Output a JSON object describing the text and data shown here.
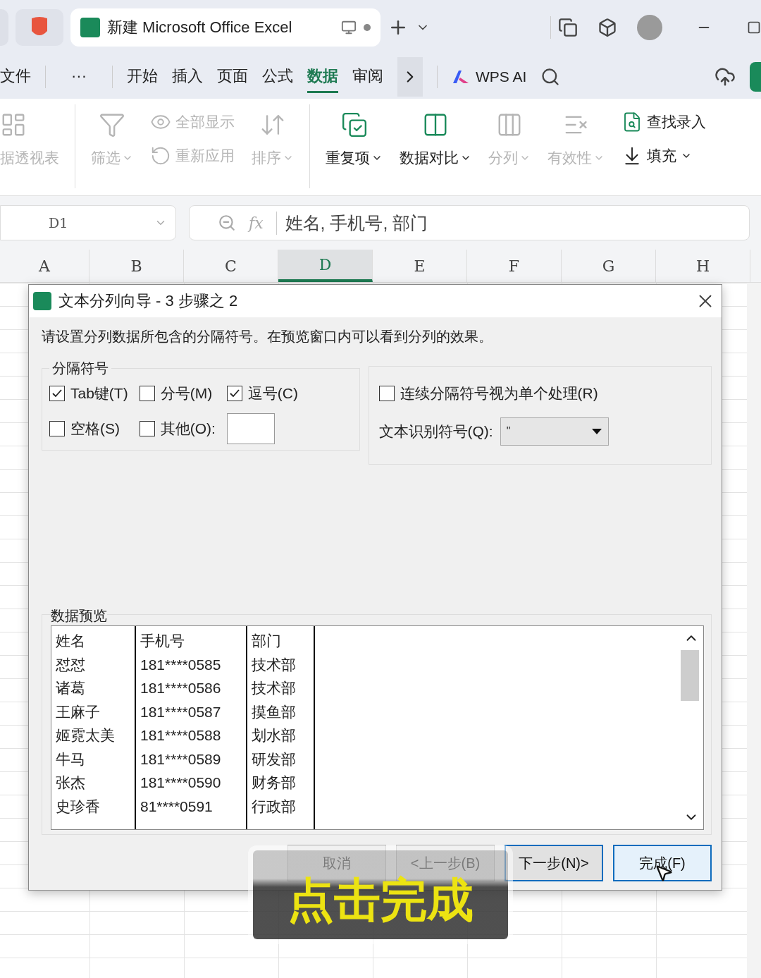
{
  "tab_bar": {
    "tab_title": "新建 Microsoft Office Excel"
  },
  "menu": {
    "items": [
      {
        "label": "文件",
        "selected": false
      },
      {
        "label": "···",
        "selected": false
      },
      {
        "label": "开始",
        "selected": false
      },
      {
        "label": "插入",
        "selected": false
      },
      {
        "label": "页面",
        "selected": false
      },
      {
        "label": "公式",
        "selected": false
      },
      {
        "label": "数据",
        "selected": true
      },
      {
        "label": "审阅",
        "selected": false
      }
    ],
    "ai_label": "WPS AI"
  },
  "ribbon": [
    {
      "kind": "large",
      "label": "据透视表",
      "disabled": true,
      "dropdown": false
    },
    {
      "kind": "divider"
    },
    {
      "kind": "large",
      "label": "筛选",
      "disabled": true,
      "dropdown": true
    },
    {
      "kind": "stack",
      "items": [
        {
          "label": "全部显示",
          "disabled": true,
          "dropdown": false
        },
        {
          "label": "重新应用",
          "disabled": true,
          "dropdown": false
        }
      ]
    },
    {
      "kind": "large",
      "label": "排序",
      "disabled": true,
      "dropdown": true
    },
    {
      "kind": "divider"
    },
    {
      "kind": "large",
      "label": "重复项",
      "disabled": false,
      "dropdown": true
    },
    {
      "kind": "large",
      "label": "数据对比",
      "disabled": false,
      "dropdown": true
    },
    {
      "kind": "large",
      "label": "分列",
      "disabled": true,
      "dropdown": true
    },
    {
      "kind": "large",
      "label": "有效性",
      "disabled": true,
      "dropdown": true
    },
    {
      "kind": "stack",
      "items": [
        {
          "label": "查找录入",
          "disabled": false,
          "dropdown": false
        },
        {
          "label": "填充",
          "disabled": false,
          "dropdown": true
        }
      ]
    }
  ],
  "formula_bar": {
    "cell": "D1",
    "fx_label": "fx",
    "formula": "姓名, 手机号, 部门"
  },
  "columns": [
    {
      "label": "A",
      "selected": false
    },
    {
      "label": "B",
      "selected": false
    },
    {
      "label": "C",
      "selected": false
    },
    {
      "label": "D",
      "selected": true
    },
    {
      "label": "E",
      "selected": false
    },
    {
      "label": "F",
      "selected": false
    },
    {
      "label": "G",
      "selected": false
    },
    {
      "label": "H",
      "selected": false
    }
  ],
  "dialog": {
    "title": "文本分列向导 - 3 步骤之 2",
    "instruction": "请设置分列数据所包含的分隔符号。在预览窗口内可以看到分列的效果。",
    "delimiters": {
      "legend": "分隔符号",
      "options": [
        {
          "label": "Tab键(T)",
          "checked": true
        },
        {
          "label": "分号(M)",
          "checked": false
        },
        {
          "label": "逗号(C)",
          "checked": true
        },
        {
          "label": "空格(S)",
          "checked": false
        },
        {
          "label": "其他(O):",
          "checked": false
        }
      ]
    },
    "consecutive": {
      "label": "连续分隔符号视为单个处理(R)",
      "checked": false
    },
    "qualifier": {
      "label": "文本识别符号(Q):",
      "value": "\""
    },
    "preview": {
      "label": "数据预览",
      "rows": [
        [
          "姓名",
          "手机号",
          "部门"
        ],
        [
          "怼怼",
          "181****0585",
          "技术部"
        ],
        [
          "诸葛",
          "181****0586",
          "技术部"
        ],
        [
          "王麻子",
          "181****0587",
          "摸鱼部"
        ],
        [
          "姬霓太美",
          "181****0588",
          "划水部"
        ],
        [
          "牛马",
          "181****0589",
          "研发部"
        ],
        [
          "张杰",
          "181****0590",
          "财务部"
        ],
        [
          "史珍香",
          "81****0591",
          "行政部"
        ]
      ]
    },
    "buttons": [
      {
        "label": "取消",
        "kind": "normal"
      },
      {
        "label": "<上一步(B)",
        "kind": "normal"
      },
      {
        "label": "下一步(N)>",
        "kind": "default"
      },
      {
        "label": "完成(F)",
        "kind": "hover"
      }
    ]
  },
  "caption": "点击完成"
}
